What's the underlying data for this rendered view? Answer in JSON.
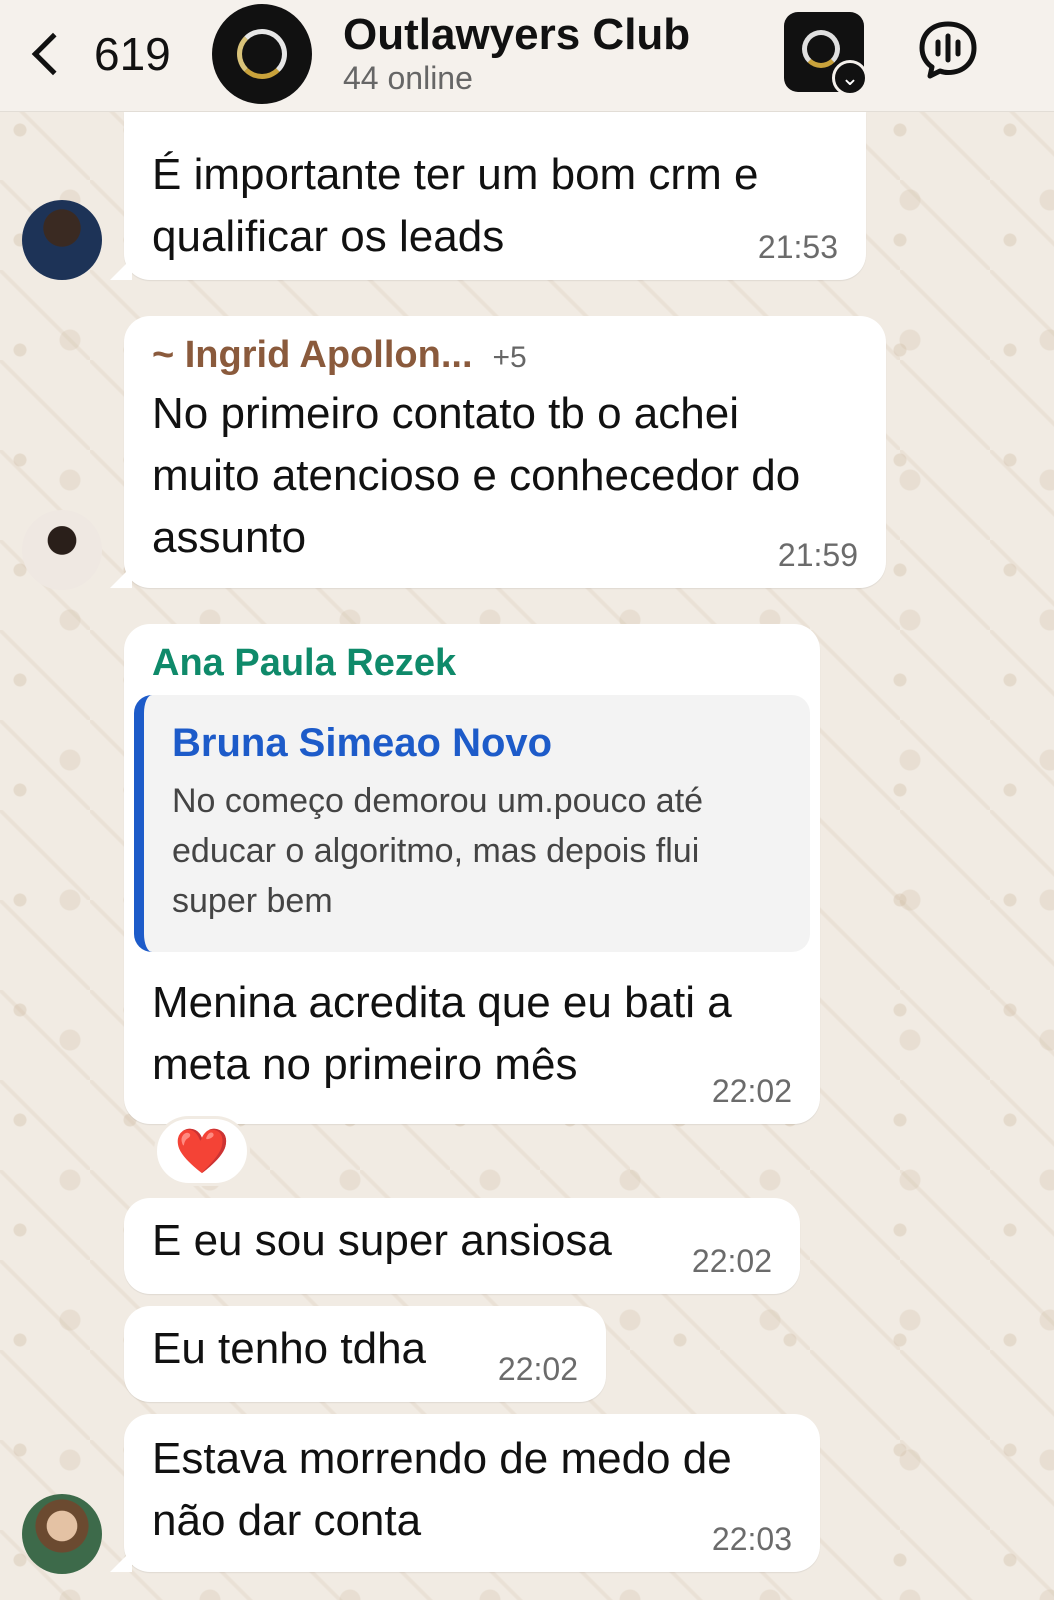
{
  "header": {
    "back_count": "619",
    "title": "Outlawyers Club",
    "subtitle": "44 online"
  },
  "messages": [
    {
      "text": "É importante ter um bom crm e qualificar os leads",
      "time": "21:53"
    },
    {
      "sender": "~ Ingrid Apollon...",
      "sender_extra": "+5",
      "text": "No primeiro contato tb o achei muito atencioso e conhecedor do assunto",
      "time": "21:59"
    },
    {
      "sender": "Ana Paula Rezek",
      "quote": {
        "name": "Bruna Simeao Novo",
        "text": "No começo demorou um.pouco até educar o algoritmo, mas depois flui super bem"
      },
      "text": "Menina acredita que eu bati a meta no primeiro mês",
      "time": "22:02",
      "reaction": "❤️"
    },
    {
      "text": "E eu sou super ansiosa",
      "time": "22:02"
    },
    {
      "text": "Eu tenho tdha",
      "time": "22:02"
    },
    {
      "text": "Estava morrendo de medo de não dar conta",
      "time": "22:03"
    }
  ],
  "colors": {
    "ingrid_name": "#8a5a3c",
    "ana_name": "#0f8a6a",
    "quote_accent": "#1d5bc9"
  },
  "icons": [
    "back-chevron-icon",
    "group-avatar-icon",
    "community-icon",
    "voice-chat-icon"
  ]
}
